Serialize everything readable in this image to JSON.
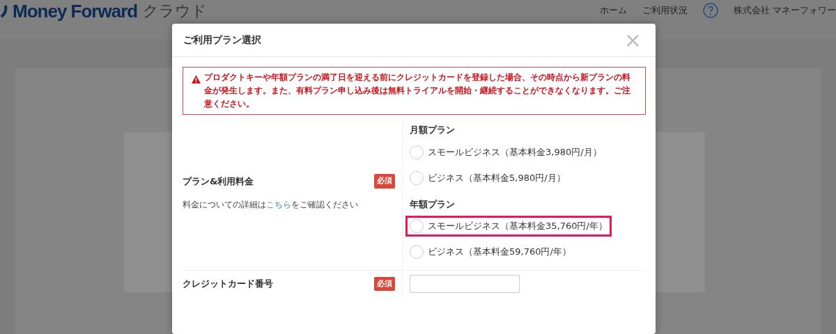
{
  "header": {
    "logo": "Money Forward",
    "logo_suffix": "クラウド",
    "nav": [
      "ホーム",
      "ご利用状況"
    ],
    "company": "株式会社 マネーフォワー"
  },
  "modal": {
    "title": "ご利用プラン選択",
    "close": "×",
    "alert": "プロダクトキーや年額プランの満了日を迎える前にクレジットカードを登録した場合、その時点から新プランの料金が発生します。また、有料プラン申し込み後は無料トライアルを開始・継続することができなくなります。ご注意ください。",
    "rows": [
      {
        "kind": "plans",
        "label": "プラン&利用料金",
        "badge": "必須",
        "note_before": "料金についての詳細は",
        "note_link": "こちら",
        "note_after": "をご確認ください",
        "groups": [
          {
            "heading": "月額プラン",
            "options": [
              {
                "label": "スモールビジネス（基本料金3,980円/月）",
                "checked": false,
                "highlighted": false
              },
              {
                "label": "ビジネス（基本料金5,980円/月）",
                "checked": false,
                "highlighted": false
              }
            ]
          },
          {
            "heading": "年額プラン",
            "options": [
              {
                "label": "スモールビジネス（基本料金35,760円/年）",
                "checked": false,
                "highlighted": true
              },
              {
                "label": "ビジネス（基本料金59,760円/年）",
                "checked": false,
                "highlighted": false
              }
            ]
          }
        ]
      },
      {
        "kind": "input",
        "label": "クレジットカード番号",
        "badge": "必須"
      }
    ]
  }
}
